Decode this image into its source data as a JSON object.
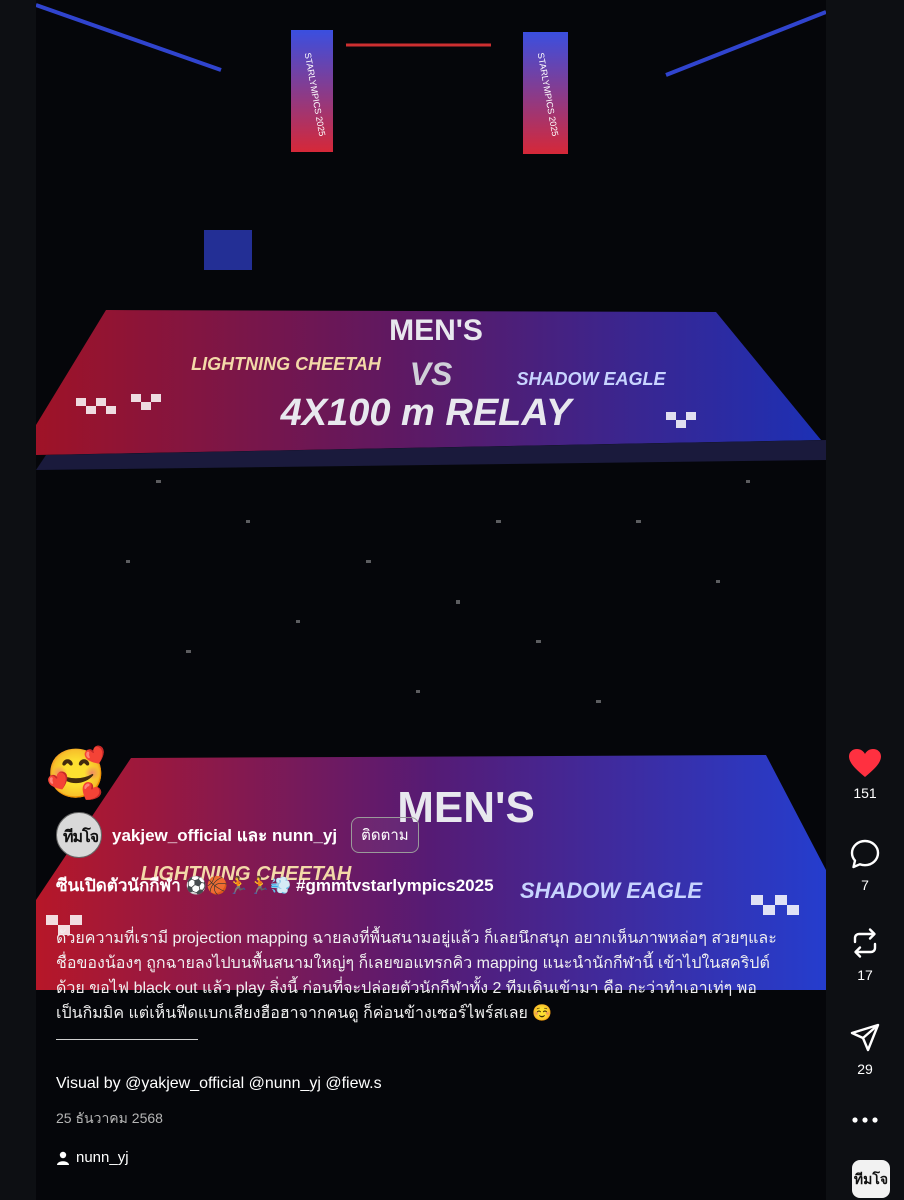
{
  "video": {
    "court_top": {
      "line1": "MEN'S",
      "line2": "4X100 m RELAY",
      "vs": "VS",
      "team_left": "LIGHTNING CHEETAH",
      "team_right": "SHADOW EAGLE"
    },
    "screens": {
      "left": "STARLYMPICS 2025",
      "right": "STARLYMPICS 2025"
    },
    "court_bottom": {
      "line1": "MEN'S",
      "team_left": "LIGHTNING CHEETAH",
      "team_right": "SHADOW EAGLE"
    }
  },
  "post": {
    "sticker_emoji": "🥰",
    "avatar_text": "ทีมโจ",
    "authors": "yakjew_official และ nunn_yj",
    "follow_label": "ติดตาม",
    "title": "ซีนเปิดตัวนักกีฬา ⚽🏀🏃🏃💨 #gmmtvstarlympics2025",
    "body": "ด้วยความที่เรามี projection mapping ฉายลงที่พื้นสนามอยู่แล้ว ก็เลยนึกสนุก อยากเห็นภาพหล่อๆ สวยๆและชื่อของน้องๆ ถูกฉายลงไปบนพื้นสนามใหญ่ๆ ก็เลยขอแทรกคิว mapping แนะนำนักกีฬานี้ เข้าไปในสคริปต์ด้วย ขอไฟ black out แล้ว play สิ่งนี้ ก่อนที่จะปล่อยตัวนักกีฬาทั้ง 2 ทีมเดินเข้ามา คือ กะว่าทำเอาเท่ๆ พอเป็นกิมมิค แต่เห็นฟีดแบกเสียงฮือฮาจากคนดู ก็ค่อนข้างเซอร์ไพร์สเลย ☺️",
    "visual_by": "Visual by @yakjew_official @nunn_yj @fiew.s",
    "date": "25 ธันวาคม 2568",
    "username": "nunn_yj"
  },
  "actions": {
    "like_count": "151",
    "comment_count": "7",
    "repost_count": "17",
    "share_count": "29",
    "heart_color": "#ff3040"
  },
  "app_badge": "ทีมโจ"
}
